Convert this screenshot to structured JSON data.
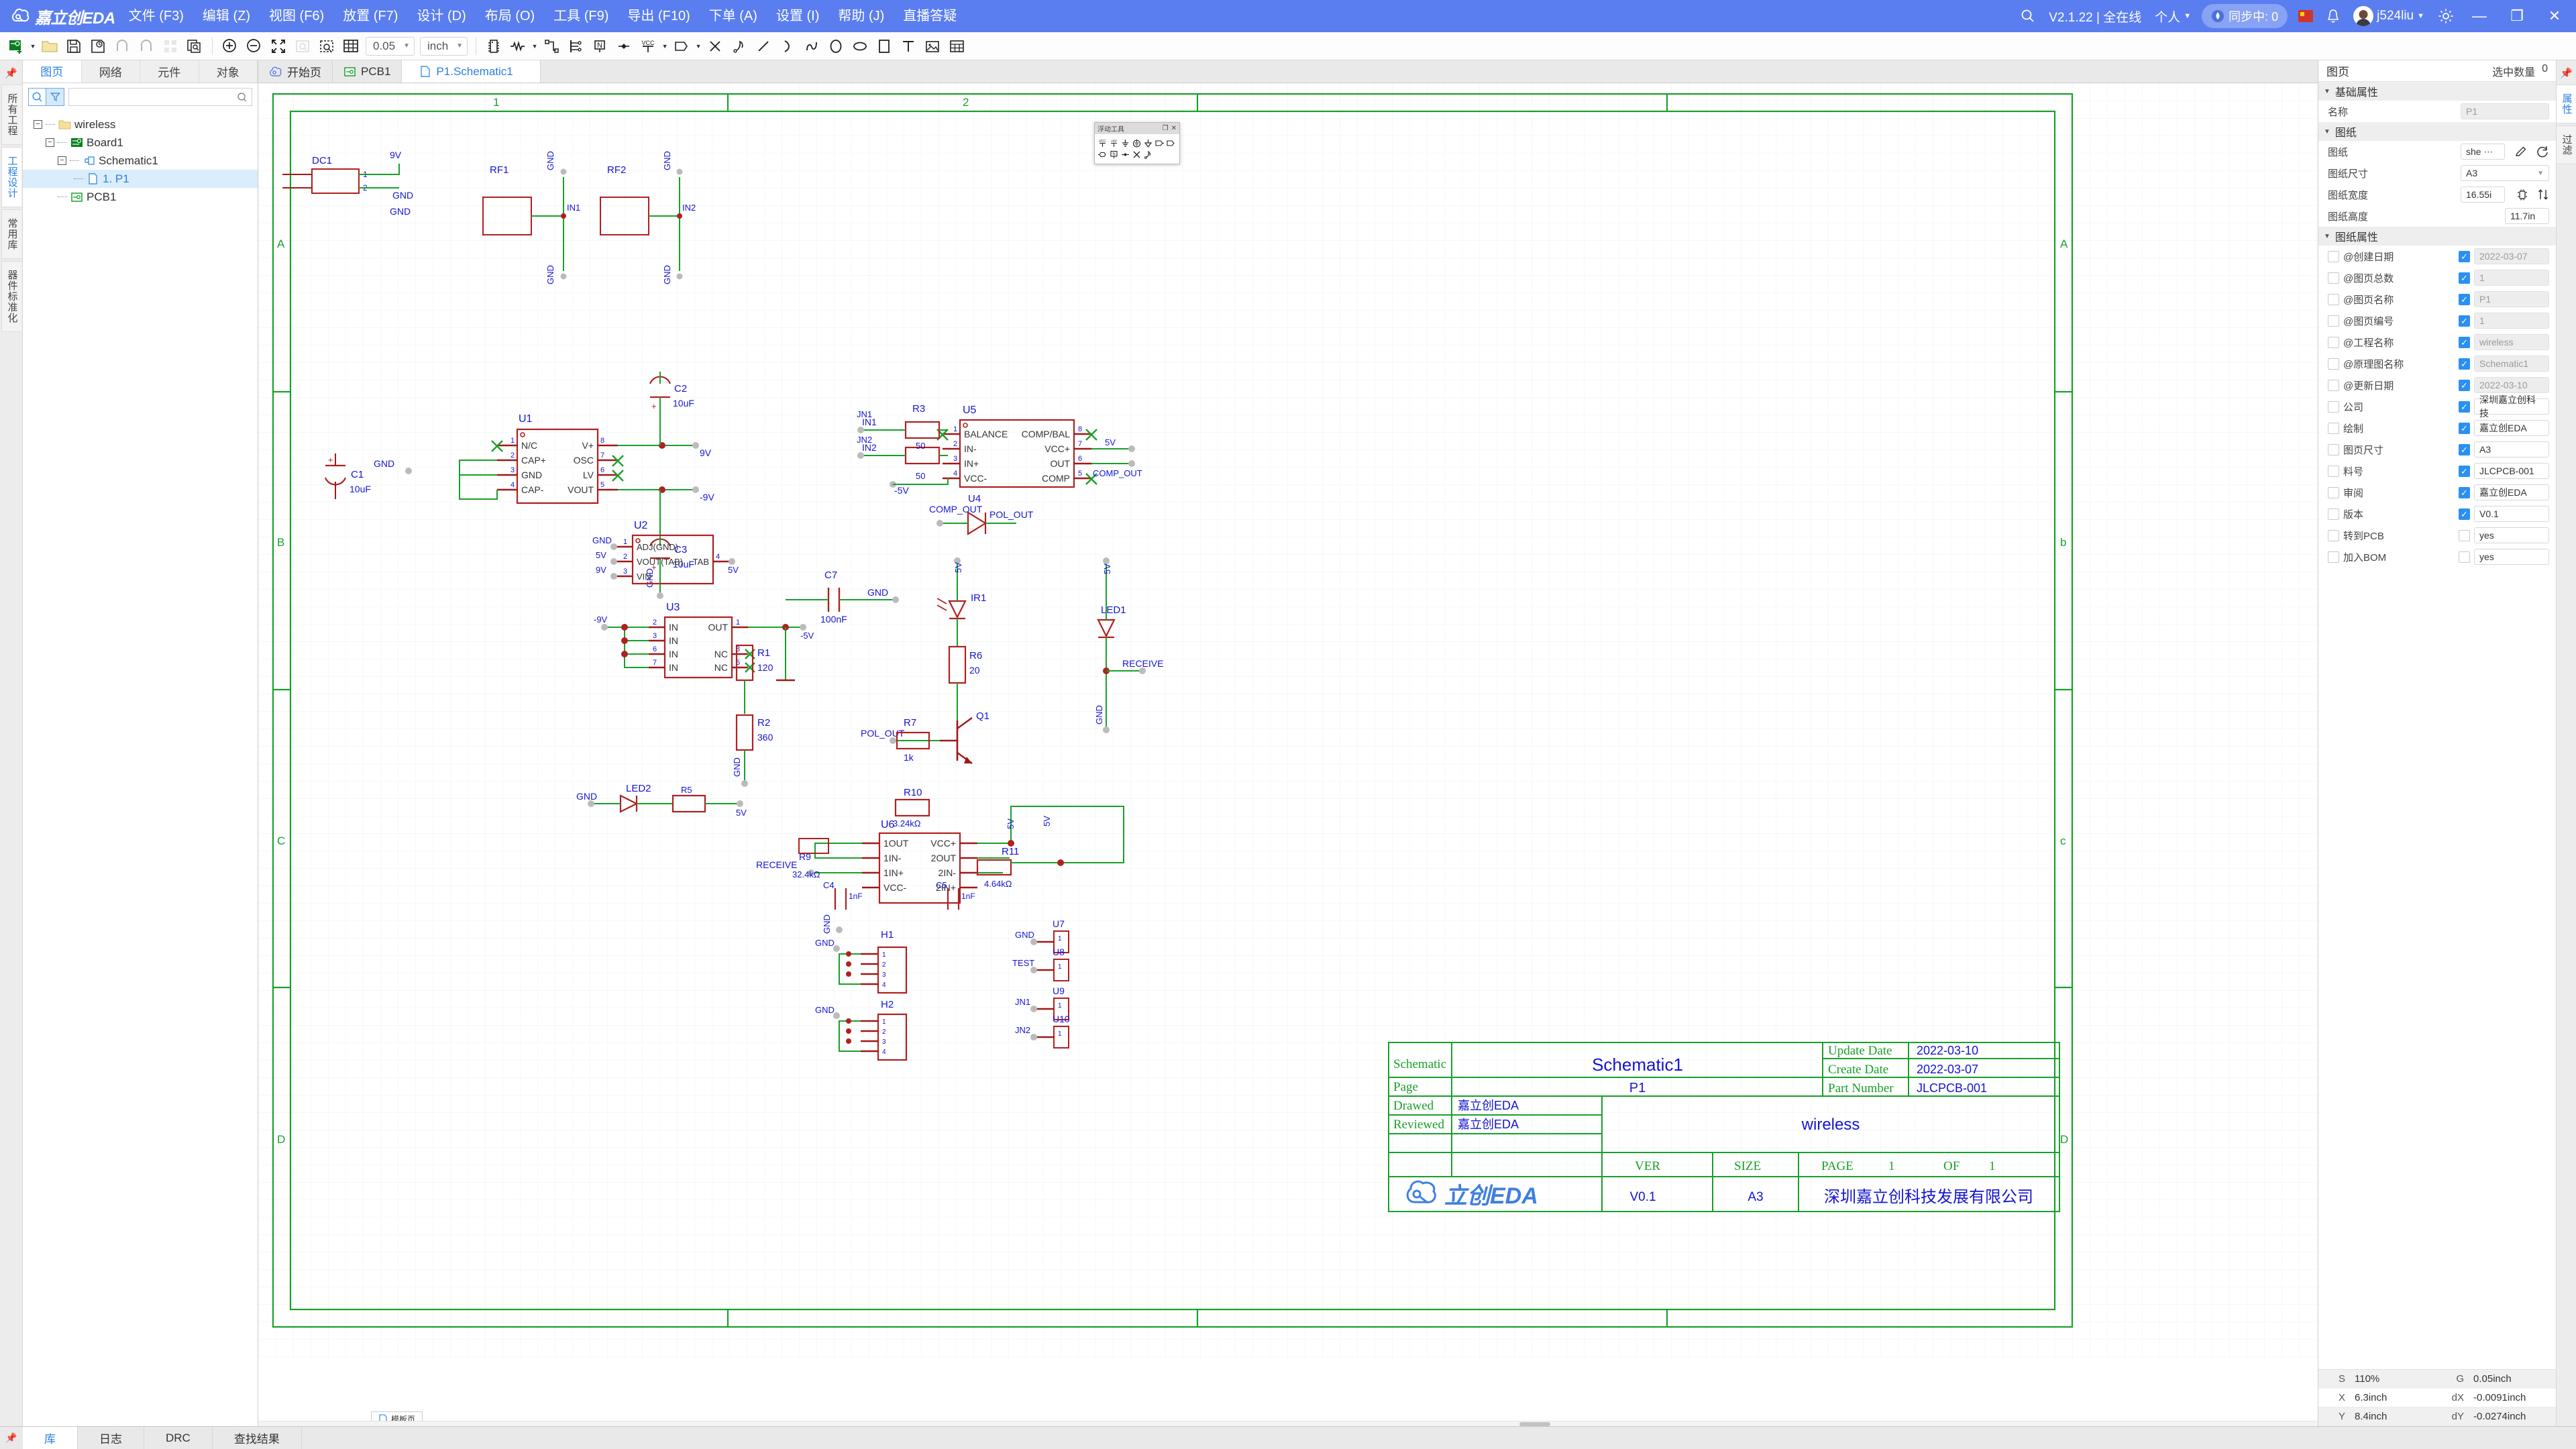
{
  "app": {
    "brand": "嘉立创EDA",
    "brand_logo_icon": "cloud-logo-icon"
  },
  "menubar": {
    "items": [
      {
        "label": "文件 (F3)",
        "name": "menu-file"
      },
      {
        "label": "编辑 (Z)",
        "name": "menu-edit"
      },
      {
        "label": "视图 (F6)",
        "name": "menu-view"
      },
      {
        "label": "放置 (F7)",
        "name": "menu-place"
      },
      {
        "label": "设计 (D)",
        "name": "menu-design"
      },
      {
        "label": "布局 (O)",
        "name": "menu-layout"
      },
      {
        "label": "工具 (F9)",
        "name": "menu-tools"
      },
      {
        "label": "导出 (F10)",
        "name": "menu-export"
      },
      {
        "label": "下单 (A)",
        "name": "menu-order"
      },
      {
        "label": "设置 (I)",
        "name": "menu-settings"
      },
      {
        "label": "帮助 (J)",
        "name": "menu-help"
      },
      {
        "label": "直播答疑",
        "name": "menu-live-qa"
      }
    ],
    "search_icon": "search-icon",
    "version": "V2.1.22 | 全在线",
    "account_mode": "个人",
    "sync_status": "同步中: 0",
    "username": "j524liu",
    "notification_icon": "bell-icon",
    "gear_icon": "gear-icon",
    "minimize": "—",
    "restore": "❐",
    "close": "✕"
  },
  "toolbar": {
    "grid_step": "0.05",
    "unit": "inch",
    "icons": [
      "new-document-icon",
      "open-folder-icon",
      "save-icon",
      "save-as-icon",
      "undo-icon",
      "redo-icon",
      "panels-icon",
      "copy-preview-icon",
      "zoom-in-icon",
      "zoom-out-icon",
      "fit-screen-icon",
      "zoom-selection-icon",
      "area-zoom-icon",
      "grid-icon",
      "chip-icon",
      "resistor-icon",
      "wire-icon",
      "bus-icon",
      "netlabel-icon",
      "junction-icon",
      "vcc-icon",
      "netport-icon",
      "no-connect-icon",
      "pin-icon",
      "line-icon",
      "arc-icon",
      "polyline-icon",
      "circle-icon",
      "ellipse-icon",
      "rect-icon",
      "text-icon",
      "image-icon",
      "table-icon"
    ]
  },
  "left_rail": {
    "pin_icon": "pin-icon",
    "tabs": [
      {
        "label": "所有工程",
        "active": false
      },
      {
        "label": "工程设计",
        "active": true
      },
      {
        "label": "常用库",
        "active": false
      },
      {
        "label": "器件标准化",
        "active": false
      }
    ]
  },
  "left_panel": {
    "tabs": [
      {
        "label": "图页",
        "active": true
      },
      {
        "label": "网络",
        "active": false
      },
      {
        "label": "元件",
        "active": false
      },
      {
        "label": "对象",
        "active": false
      }
    ],
    "search_placeholder": "",
    "search_value": "",
    "search_icon": "search-icon",
    "filter_icon": "filter-icon",
    "tree": [
      {
        "label": "wireless",
        "depth": 0,
        "icon": "folder-icon",
        "expandable": true,
        "selected": false
      },
      {
        "label": "Board1",
        "depth": 1,
        "icon": "board-icon",
        "expandable": true,
        "selected": false
      },
      {
        "label": "Schematic1",
        "depth": 2,
        "icon": "schematic-icon",
        "expandable": true,
        "selected": false
      },
      {
        "label": "1. P1",
        "depth": 3,
        "icon": "page-icon",
        "expandable": false,
        "selected": true
      },
      {
        "label": "PCB1",
        "depth": 2,
        "icon": "pcb-icon",
        "expandable": false,
        "selected": false
      }
    ]
  },
  "doc_tabs": [
    {
      "label": "开始页",
      "icon": "cloud-icon",
      "active": false
    },
    {
      "label": "PCB1",
      "icon": "pcb-icon",
      "active": false
    },
    {
      "label": "P1.Schematic1",
      "icon": "page-icon",
      "active": true
    }
  ],
  "float_panel": {
    "title": "浮动工具",
    "restore_icon": "restore-icon",
    "close_icon": "close-icon",
    "tools": [
      "vcc-icon",
      "plus5v-icon",
      "gnd-icon",
      "earth-ground-icon",
      "arrow-ground-icon",
      "netport-right-icon",
      "netport-left-icon",
      "netflag-icon",
      "netlabel-n-icon",
      "junction-icon",
      "no-connect-icon",
      "pin-icon"
    ]
  },
  "canvas": {
    "template_tab": "模板页",
    "template_icon": "page-icon",
    "border_letters_left": [
      "A",
      "B",
      "C",
      "D"
    ],
    "border_letters_right": [
      "A",
      "b",
      "c",
      "D"
    ],
    "border_numbers_top": [
      "1",
      "2"
    ],
    "title_block": {
      "schematic_label": "Schematic",
      "schematic_value": "Schematic1",
      "page_label": "Page",
      "page_value": "P1",
      "drawed_label": "Drawed",
      "drawed_value": "嘉立创EDA",
      "reviewed_label": "Reviewed",
      "reviewed_value": "嘉立创EDA",
      "update_date_label": "Update Date",
      "update_date_value": "2022-03-10",
      "create_date_label": "Create Date",
      "create_date_value": "2022-03-07",
      "part_number_label": "Part Number",
      "part_number_value": "JLCPCB-001",
      "project_name": "wireless",
      "ver_label": "VER",
      "size_label": "SIZE",
      "page_col_label": "PAGE",
      "page_col_value": "1",
      "of_label": "OF",
      "of_value": "1",
      "ver_value": "V0.1",
      "size_value": "A3",
      "company": "深圳嘉立创科技发展有限公司",
      "logo_text": "立创EDA"
    },
    "components": [
      {
        "ref": "DC1",
        "pins": [
          "1",
          "2"
        ],
        "nets": [
          "9V",
          "GND"
        ]
      },
      {
        "ref": "RF1",
        "nets": [
          "GND",
          "IN1",
          "GND"
        ]
      },
      {
        "ref": "RF2",
        "nets": [
          "GND",
          "IN2",
          "GND"
        ]
      },
      {
        "ref": "U1",
        "value": "",
        "pins": [
          "N/C",
          "CAP+",
          "GND",
          "CAP-",
          "V+",
          "OSC",
          "LV",
          "VOUT"
        ]
      },
      {
        "ref": "C1",
        "value": "10uF"
      },
      {
        "ref": "C2",
        "value": "10uF"
      },
      {
        "ref": "C3",
        "value": "10uF"
      },
      {
        "ref": "U2",
        "pins": [
          "ADJ(GND)",
          "VOUT(TAB)",
          "VIN",
          "TAB"
        ]
      },
      {
        "ref": "U3",
        "pins": [
          "IN",
          "IN",
          "IN",
          "IN",
          "OUT",
          "NC",
          "NC"
        ]
      },
      {
        "ref": "C7",
        "value": "100nF"
      },
      {
        "ref": "R1",
        "value": "120"
      },
      {
        "ref": "R2",
        "value": "360"
      },
      {
        "ref": "R3",
        "value": "50"
      },
      {
        "ref": "U5",
        "pins": [
          "BALANCE",
          "IN-",
          "IN+",
          "VCC-",
          "COMP/BAL",
          "VCC+",
          "OUT",
          "COMP"
        ]
      },
      {
        "ref": "U4",
        "nets": [
          "COMP_OUT",
          "POL_OUT"
        ]
      },
      {
        "ref": "IR1"
      },
      {
        "ref": "LED1",
        "net": "RECEIVE"
      },
      {
        "ref": "LED2"
      },
      {
        "ref": "R6",
        "value": "20"
      },
      {
        "ref": "R7",
        "value": "1k"
      },
      {
        "ref": "Q1"
      },
      {
        "ref": "U6",
        "pins": [
          "1OUT",
          "1IN-",
          "1IN+",
          "VCC-",
          "VCC+",
          "2OUT",
          "2IN-",
          "2IN+"
        ]
      },
      {
        "ref": "R9",
        "value": "32.4kΩ"
      },
      {
        "ref": "R10",
        "value": "3.24kΩ"
      },
      {
        "ref": "R11",
        "value": "4.64kΩ"
      },
      {
        "ref": "C4"
      },
      {
        "ref": "C5"
      },
      {
        "ref": "H1"
      },
      {
        "ref": "H2"
      },
      {
        "ref": "U7"
      },
      {
        "ref": "U8"
      },
      {
        "ref": "U9"
      },
      {
        "ref": "U10"
      },
      {
        "ref": "JN1"
      },
      {
        "ref": "JN2"
      }
    ]
  },
  "right_panel": {
    "title": "图页",
    "selected_count_label": "选中数量",
    "selected_count_value": "0",
    "pin_icon": "pin-icon",
    "rail_tabs": [
      {
        "label": "属性",
        "active": true
      },
      {
        "label": "过滤",
        "active": false
      }
    ],
    "groups": [
      {
        "title": "基础属性",
        "rows": [
          {
            "label": "名称",
            "value": "P1",
            "readonly": true,
            "kind": "text"
          }
        ]
      },
      {
        "title": "图纸",
        "rows": [
          {
            "label": "图纸",
            "value": "she",
            "kind": "ellipsis",
            "edit_icon": "pencil-icon",
            "refresh_icon": "refresh-icon"
          },
          {
            "label": "图纸尺寸",
            "value": "A3",
            "kind": "select"
          },
          {
            "label": "图纸宽度",
            "value": "16.55i",
            "kind": "small"
          },
          {
            "label": "图纸高度",
            "value": "11.7in",
            "kind": "small"
          }
        ]
      }
    ],
    "props_group_title": "图纸属性",
    "props": [
      {
        "label": "@创建日期",
        "checked": false,
        "visible": true,
        "value": "2022-03-07",
        "readonly": true
      },
      {
        "label": "@图页总数",
        "checked": false,
        "visible": true,
        "value": "1",
        "readonly": true
      },
      {
        "label": "@图页名称",
        "checked": false,
        "visible": true,
        "value": "P1",
        "readonly": true
      },
      {
        "label": "@图页编号",
        "checked": false,
        "visible": true,
        "value": "1",
        "readonly": true
      },
      {
        "label": "@工程名称",
        "checked": false,
        "visible": true,
        "value": "wireless",
        "readonly": true
      },
      {
        "label": "@原理图名称",
        "checked": false,
        "visible": true,
        "value": "Schematic1",
        "readonly": true
      },
      {
        "label": "@更新日期",
        "checked": false,
        "visible": true,
        "value": "2022-03-10",
        "readonly": true
      },
      {
        "label": "公司",
        "checked": false,
        "visible": true,
        "value": "深圳嘉立创科技",
        "readonly": false
      },
      {
        "label": "绘制",
        "checked": false,
        "visible": true,
        "value": "嘉立创EDA",
        "readonly": false
      },
      {
        "label": "图页尺寸",
        "checked": false,
        "visible": true,
        "value": "A3",
        "readonly": false
      },
      {
        "label": "料号",
        "checked": false,
        "visible": true,
        "value": "JLCPCB-001",
        "readonly": false
      },
      {
        "label": "审阅",
        "checked": false,
        "visible": true,
        "value": "嘉立创EDA",
        "readonly": false
      },
      {
        "label": "版本",
        "checked": false,
        "visible": true,
        "value": "V0.1",
        "readonly": false
      },
      {
        "label": "转到PCB",
        "checked": false,
        "visible": false,
        "value": "yes",
        "readonly": false
      },
      {
        "label": "加入BOM",
        "checked": false,
        "visible": false,
        "value": "yes",
        "readonly": false
      }
    ],
    "status": [
      {
        "k1": "S",
        "v1": "110%",
        "k2": "G",
        "v2": "0.05inch"
      },
      {
        "k1": "X",
        "v1": "6.3inch",
        "k2": "dX",
        "v2": "-0.0091inch"
      },
      {
        "k1": "Y",
        "v1": "8.4inch",
        "k2": "dY",
        "v2": "-0.0274inch"
      }
    ]
  },
  "bottombar": {
    "pin_icon": "pin-icon",
    "tabs": [
      {
        "label": "库",
        "active": true
      },
      {
        "label": "日志",
        "active": false
      },
      {
        "label": "DRC",
        "active": false
      },
      {
        "label": "查找结果",
        "active": false
      }
    ]
  }
}
